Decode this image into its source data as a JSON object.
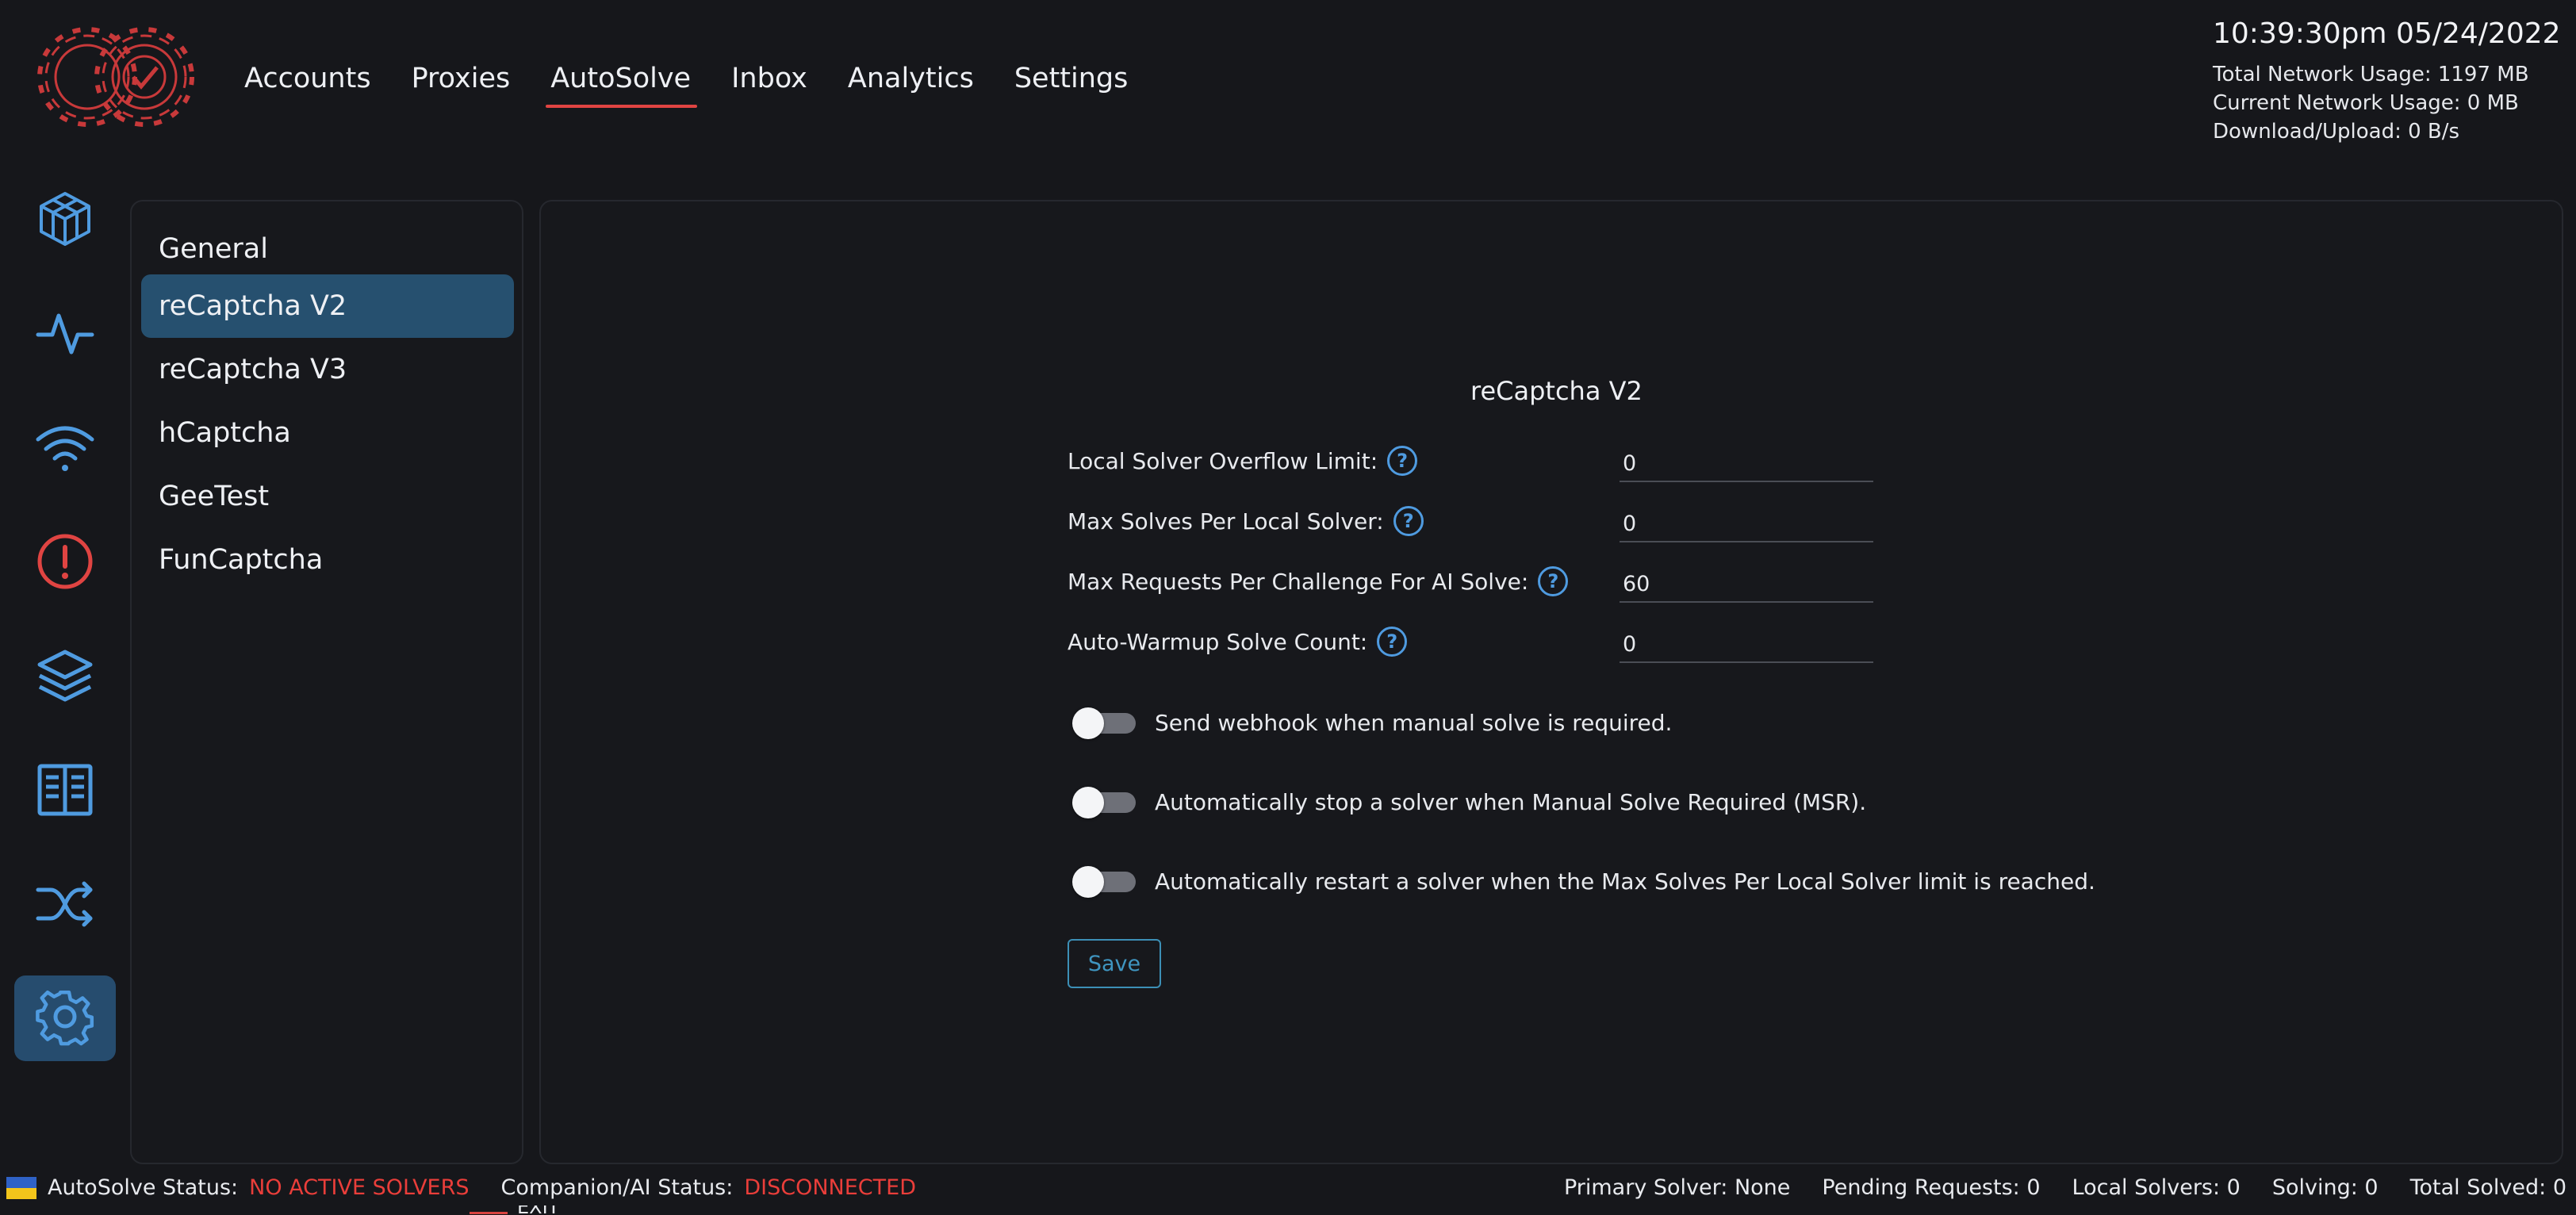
{
  "header": {
    "nav": [
      "Accounts",
      "Proxies",
      "AutoSolve",
      "Inbox",
      "Analytics",
      "Settings"
    ],
    "active_nav": "AutoSolve"
  },
  "stats": {
    "clock": "10:39:30pm 05/24/2022",
    "total_network": "Total Network Usage:  1197 MB",
    "current_network": "Current Network Usage: 0 MB",
    "download_upload": "Download/Upload: 0 B/s"
  },
  "rail": {
    "icons": [
      "cube-icon",
      "activity-icon",
      "wifi-icon",
      "alert-icon",
      "layers-icon",
      "book-icon",
      "shuffle-icon",
      "gear-icon"
    ],
    "active": "gear-icon"
  },
  "submenu": {
    "items": [
      "General",
      "reCaptcha V2",
      "reCaptcha V3",
      "hCaptcha",
      "GeeTest",
      "FunCaptcha"
    ],
    "active": "reCaptcha V2"
  },
  "form": {
    "title": "reCaptcha V2",
    "fields": [
      {
        "label": "Local Solver Overflow Limit:",
        "value": "0"
      },
      {
        "label": "Max Solves Per Local Solver:",
        "value": "0"
      },
      {
        "label": "Max Requests Per Challenge For AI Solve:",
        "value": "60"
      },
      {
        "label": "Auto-Warmup Solve Count:",
        "value": "0"
      }
    ],
    "toggles": [
      {
        "label": "Send webhook when manual solve is required.",
        "on": false
      },
      {
        "label": "Automatically stop a solver when Manual Solve Required (MSR).",
        "on": false
      },
      {
        "label": "Automatically restart a solver when the Max Solves Per Local Solver limit is reached.",
        "on": false
      }
    ],
    "save_label": "Save"
  },
  "statusbar": {
    "autosolve_label": "AutoSolve Status:",
    "autosolve_value": "NO ACTIVE SOLVERS",
    "companion_label": "Companion/AI Status:",
    "companion_value": "DISCONNECTED",
    "primary_solver": "Primary Solver: None",
    "pending_requests": "Pending Requests: 0",
    "local_solvers": "Local Solvers: 0",
    "solving": "Solving: 0",
    "total_solved": "Total Solved: 0",
    "exit_fragment": "EXIT"
  },
  "colors": {
    "background": "#16171b",
    "accent_red": "#e04442",
    "accent_blue": "#4f9be0",
    "active_bg": "#26506f",
    "error_text": "#ea3e3a"
  }
}
